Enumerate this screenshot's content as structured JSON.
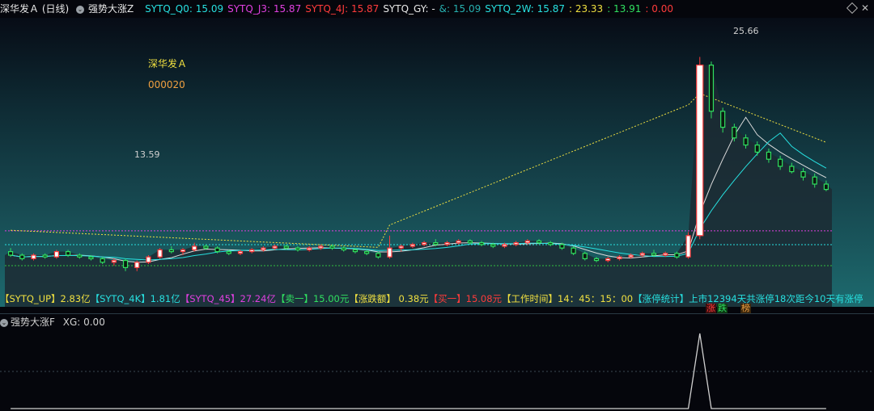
{
  "header": {
    "stock_title": "深华发Ａ (日线)",
    "indicator_name": "强势大涨Z",
    "items": [
      {
        "label": "SYTQ_Q0: 15.09",
        "color": "#27e0e0"
      },
      {
        "label": "SYTQ_J3: 15.87",
        "color": "#e040e0"
      },
      {
        "label": "SYTQ_4J: 15.87",
        "color": "#ff3b3b"
      },
      {
        "label": "SYTQ_GY: -",
        "color": "#e8e8e8"
      },
      {
        "label": "&: 15.09",
        "color": "#27b0b0"
      },
      {
        "label": "SYTQ_2W: 15.87",
        "color": "#27e0e0"
      },
      {
        "label": ": 23.33",
        "color": "#f0e040"
      },
      {
        "label": ": 13.91",
        "color": "#30e060"
      },
      {
        "label": ": 0.00",
        "color": "#ff3b3b"
      }
    ],
    "close_glyph": "✕"
  },
  "overlay": {
    "stock_name": "深华发Ａ",
    "stock_code": "000020",
    "high_label": "25.66",
    "low_label": "13.59"
  },
  "status_bar": {
    "segments": [
      {
        "text": "【SYTQ_UP】2.83亿",
        "color": "#f0e040"
      },
      {
        "text": "【SYTQ_4K】1.81亿",
        "color": "#27e0e0"
      },
      {
        "text": "【SYTQ_45】27.24亿",
        "color": "#e040e0"
      },
      {
        "text": "【卖一】15.00元",
        "color": "#30e060"
      },
      {
        "text": "【涨跌额】 0.38元",
        "color": "#f0e040"
      },
      {
        "text": "【买一】15.08元",
        "color": "#ff3b3b"
      },
      {
        "text": "【工作时间】14：45：15：00",
        "color": "#f0e040"
      },
      {
        "text": "【涨停统计】上市12394天共涨停18次距今10天有涨停",
        "color": "#27e0e0"
      }
    ],
    "badges": [
      {
        "text": "涨",
        "color": "#ff3b3b",
        "bg": "#3a0d0d"
      },
      {
        "text": "跌",
        "color": "#30e060",
        "bg": "#0d3a14"
      },
      {
        "text": "榜",
        "color": "#f0a040",
        "bg": "#3a260d"
      }
    ]
  },
  "sub_indicator": {
    "name": "强势大涨F",
    "value_label": "XG: 0.00"
  },
  "chart_data": {
    "type": "candlestick",
    "high_price": 25.66,
    "low_price": 13.59,
    "y_range": [
      12.5,
      27.5
    ],
    "ohlc": [
      [
        14.7,
        14.9,
        14.4,
        14.5
      ],
      [
        14.5,
        14.6,
        14.2,
        14.3
      ],
      [
        14.3,
        14.6,
        14.2,
        14.5
      ],
      [
        14.5,
        14.6,
        14.3,
        14.4
      ],
      [
        14.4,
        14.8,
        14.3,
        14.7
      ],
      [
        14.7,
        14.8,
        14.4,
        14.5
      ],
      [
        14.5,
        14.6,
        14.3,
        14.4
      ],
      [
        14.4,
        14.5,
        14.2,
        14.3
      ],
      [
        14.3,
        14.4,
        14.0,
        14.1
      ],
      [
        14.1,
        14.3,
        13.9,
        14.2
      ],
      [
        14.2,
        14.3,
        13.6,
        13.8
      ],
      [
        13.8,
        14.2,
        13.6,
        14.1
      ],
      [
        14.1,
        14.5,
        14.0,
        14.4
      ],
      [
        14.4,
        14.9,
        14.3,
        14.8
      ],
      [
        14.8,
        15.0,
        14.6,
        14.7
      ],
      [
        14.7,
        14.9,
        14.5,
        14.8
      ],
      [
        14.8,
        15.2,
        14.7,
        15.0
      ],
      [
        15.0,
        15.1,
        14.8,
        14.9
      ],
      [
        14.9,
        15.0,
        14.6,
        14.7
      ],
      [
        14.7,
        14.8,
        14.5,
        14.6
      ],
      [
        14.6,
        14.8,
        14.5,
        14.7
      ],
      [
        14.7,
        14.9,
        14.6,
        14.8
      ],
      [
        14.8,
        15.0,
        14.7,
        14.9
      ],
      [
        14.9,
        15.1,
        14.8,
        15.0
      ],
      [
        15.0,
        15.1,
        14.8,
        14.9
      ],
      [
        14.9,
        15.0,
        14.7,
        14.8
      ],
      [
        14.8,
        15.0,
        14.7,
        14.9
      ],
      [
        14.9,
        15.1,
        14.8,
        15.0
      ],
      [
        15.0,
        15.1,
        14.8,
        14.9
      ],
      [
        14.9,
        15.0,
        14.7,
        14.8
      ],
      [
        14.8,
        14.9,
        14.6,
        14.7
      ],
      [
        14.7,
        14.8,
        14.5,
        14.6
      ],
      [
        14.6,
        14.7,
        14.3,
        14.4
      ],
      [
        14.4,
        15.6,
        14.3,
        14.9
      ],
      [
        14.9,
        15.1,
        14.7,
        15.0
      ],
      [
        15.0,
        15.2,
        14.9,
        15.1
      ],
      [
        15.1,
        15.3,
        15.0,
        15.2
      ],
      [
        15.2,
        15.4,
        15.0,
        15.1
      ],
      [
        15.1,
        15.3,
        15.0,
        15.2
      ],
      [
        15.2,
        15.4,
        15.1,
        15.3
      ],
      [
        15.3,
        15.4,
        15.1,
        15.2
      ],
      [
        15.2,
        15.3,
        15.0,
        15.1
      ],
      [
        15.1,
        15.2,
        14.9,
        15.0
      ],
      [
        15.0,
        15.2,
        14.9,
        15.1
      ],
      [
        15.1,
        15.3,
        15.0,
        15.2
      ],
      [
        15.2,
        15.4,
        15.1,
        15.3
      ],
      [
        15.3,
        15.4,
        15.1,
        15.2
      ],
      [
        15.2,
        15.3,
        15.0,
        15.1
      ],
      [
        15.1,
        15.2,
        14.8,
        14.9
      ],
      [
        14.9,
        15.0,
        14.5,
        14.6
      ],
      [
        14.6,
        14.7,
        14.2,
        14.3
      ],
      [
        14.3,
        14.4,
        14.1,
        14.2
      ],
      [
        14.2,
        14.4,
        14.1,
        14.3
      ],
      [
        14.3,
        14.5,
        14.2,
        14.4
      ],
      [
        14.4,
        14.6,
        14.3,
        14.5
      ],
      [
        14.5,
        14.7,
        14.4,
        14.6
      ],
      [
        14.6,
        14.8,
        14.4,
        14.5
      ],
      [
        14.5,
        14.7,
        14.4,
        14.6
      ],
      [
        14.6,
        14.7,
        14.3,
        14.4
      ],
      [
        14.4,
        15.8,
        14.3,
        15.6
      ],
      [
        15.6,
        25.66,
        15.4,
        25.2
      ],
      [
        25.2,
        25.4,
        22.2,
        22.6
      ],
      [
        22.6,
        22.8,
        21.4,
        21.7
      ],
      [
        21.7,
        21.9,
        20.9,
        21.1
      ],
      [
        21.1,
        21.3,
        20.5,
        20.7
      ],
      [
        20.7,
        20.9,
        20.1,
        20.3
      ],
      [
        20.3,
        20.5,
        19.7,
        19.9
      ],
      [
        19.9,
        20.1,
        19.3,
        19.5
      ],
      [
        19.5,
        19.7,
        19.1,
        19.2
      ],
      [
        19.2,
        19.4,
        18.7,
        18.9
      ],
      [
        18.9,
        19.1,
        18.3,
        18.5
      ],
      [
        18.5,
        18.7,
        18.1,
        18.2
      ]
    ],
    "sub_series": [
      0,
      0,
      0,
      0,
      0,
      0,
      0,
      0,
      0,
      0,
      0,
      0,
      0,
      0,
      0,
      0,
      0,
      0,
      0,
      0,
      0,
      0,
      0,
      0,
      0,
      0,
      0,
      0,
      0,
      0,
      0,
      0,
      0,
      0,
      0,
      0,
      0,
      0,
      0,
      0,
      0,
      0,
      0,
      0,
      0,
      0,
      0,
      0,
      0,
      0,
      0,
      0,
      0,
      0,
      0,
      0,
      0,
      0,
      0,
      0,
      1,
      0,
      0,
      0,
      0,
      0,
      0,
      0,
      0,
      0,
      0,
      0
    ],
    "colors": {
      "up": "#ff3b3b",
      "down": "#30e060",
      "ma_white": "#dcdcdc",
      "ma_cyan": "#27e0e0",
      "ma_yellow": "#f0e040",
      "level_magenta": "#e040e0",
      "level_cyan": "#27e0e0",
      "level_green": "#30c040"
    }
  }
}
